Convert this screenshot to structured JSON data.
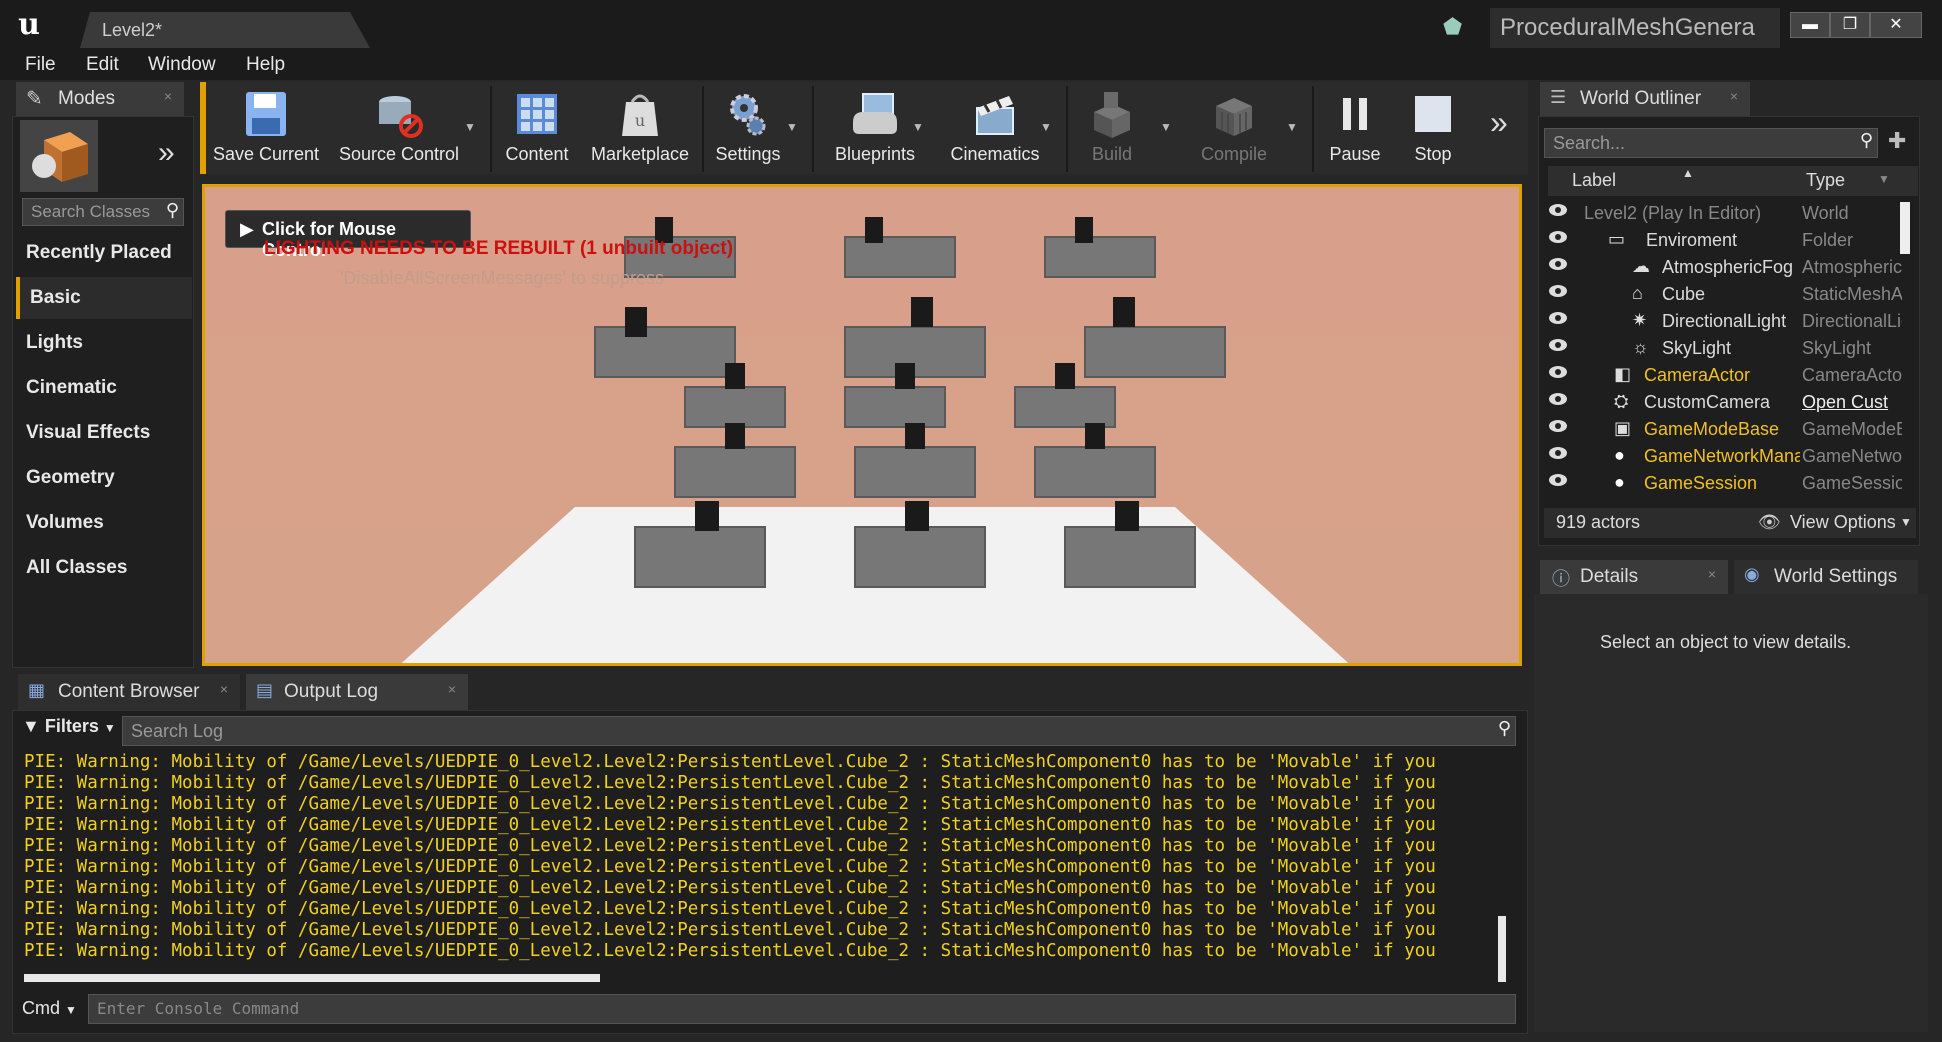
{
  "title_bar": {
    "level_tab": "Level2*",
    "project_name": "ProceduralMeshGenera",
    "minimize": "▬",
    "restore": "❐",
    "close": "✕"
  },
  "menu": [
    "File",
    "Edit",
    "Window",
    "Help"
  ],
  "modes": {
    "tab_label": "Modes",
    "tab_close": "×",
    "search_placeholder": "Search Classes",
    "categories": [
      "Recently Placed",
      "Basic",
      "Lights",
      "Cinematic",
      "Visual Effects",
      "Geometry",
      "Volumes",
      "All Classes"
    ],
    "active_category": "Basic"
  },
  "toolbar": {
    "buttons": [
      {
        "label": "Save Current",
        "icon": "save-icon"
      },
      {
        "label": "Source Control",
        "icon": "source-control-icon"
      },
      {
        "label": "Content",
        "icon": "content-icon"
      },
      {
        "label": "Marketplace",
        "icon": "marketplace-icon"
      },
      {
        "label": "Settings",
        "icon": "settings-icon"
      },
      {
        "label": "Blueprints",
        "icon": "blueprints-icon"
      },
      {
        "label": "Cinematics",
        "icon": "cinematics-icon"
      },
      {
        "label": "Build",
        "icon": "build-icon",
        "disabled": true
      },
      {
        "label": "Compile",
        "icon": "compile-icon",
        "disabled": true
      },
      {
        "label": "Pause",
        "icon": "pause-icon"
      },
      {
        "label": "Stop",
        "icon": "stop-icon"
      }
    ],
    "more": "»"
  },
  "viewport": {
    "mouse_control": "Click for Mouse Control",
    "lighting_warning": "LIGHTING NEEDS TO BE REBUILT (1 unbuilt object)",
    "disable_hint": "'DisableAllScreenMessages' to suppress",
    "accent": "#e0a000"
  },
  "world_outliner": {
    "tab_label": "World Outliner",
    "tab_close": "×",
    "search_placeholder": "Search...",
    "col_label": "Label",
    "col_type": "Type",
    "rows": [
      {
        "label": "Level2 (Play In Editor)",
        "type": "World",
        "highlight": false
      },
      {
        "label": "Enviroment",
        "type": "Folder",
        "highlight": false
      },
      {
        "label": "AtmosphericFog",
        "type": "AtmosphericFog",
        "highlight": false
      },
      {
        "label": "Cube",
        "type": "StaticMeshActor",
        "highlight": false
      },
      {
        "label": "DirectionalLight",
        "type": "DirectionalLight",
        "highlight": false
      },
      {
        "label": "SkyLight",
        "type": "SkyLight",
        "highlight": false
      },
      {
        "label": "CameraActor",
        "type": "CameraActor",
        "highlight": true
      },
      {
        "label": "CustomCamera",
        "type": "Open Cust",
        "highlight": false
      },
      {
        "label": "GameModeBase",
        "type": "GameModeBase",
        "highlight": true
      },
      {
        "label": "GameNetworkManager",
        "type": "GameNetworkManager",
        "highlight": true
      },
      {
        "label": "GameSession",
        "type": "GameSession",
        "highlight": true
      }
    ],
    "actor_count": "919 actors",
    "view_options": "View Options"
  },
  "details": {
    "tab_label": "Details",
    "tab_close": "×",
    "world_settings_label": "World Settings",
    "empty_message": "Select an object to view details."
  },
  "bottom": {
    "content_browser_tab": "Content Browser",
    "output_log_tab": "Output Log",
    "tab_close": "×",
    "filters_label": "Filters",
    "search_placeholder": "Search Log",
    "log_line": "PIE: Warning: Mobility of /Game/Levels/UEDPIE_0_Level2.Level2:PersistentLevel.Cube_2 : StaticMeshComponent0 has to be 'Movable' if you",
    "log_line_count": 10,
    "cmd_label": "Cmd",
    "cmd_placeholder": "Enter Console Command"
  }
}
